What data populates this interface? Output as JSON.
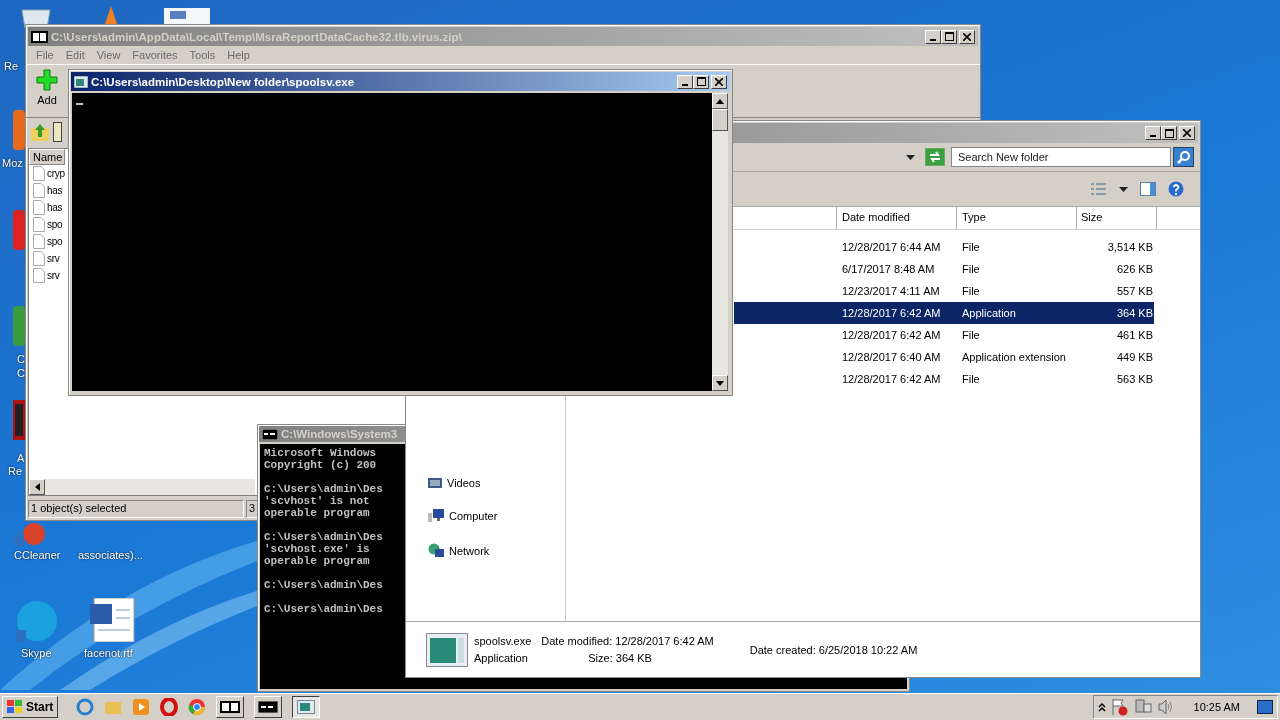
{
  "desktop_icons": [
    {
      "label": "Re"
    },
    {
      "label": "Moz"
    },
    {
      "label": "C"
    },
    {
      "label": "C"
    },
    {
      "label": "A"
    },
    {
      "label": "Re"
    },
    {
      "label": "CCleaner"
    },
    {
      "label": "associates)..."
    },
    {
      "label": "Skype"
    },
    {
      "label": "facenot.rtf"
    }
  ],
  "archive_window": {
    "title": "C:\\Users\\admin\\AppData\\Local\\Temp\\MsraReportDataCache32.tlb.virus.zip\\",
    "menu": [
      "File",
      "Edit",
      "View",
      "Favorites",
      "Tools",
      "Help"
    ],
    "add_label": "Add",
    "column": "Name",
    "files": [
      "cryp",
      "has",
      "has",
      "spo",
      "spo",
      "srv",
      "srv"
    ],
    "status": "1 object(s) selected",
    "status_2": "3"
  },
  "cmd_window": {
    "title": "C:\\Windows\\System3",
    "blocks": [
      [
        "Microsoft Windows",
        "Copyright (c) 200"
      ],
      [
        "C:\\Users\\admin\\Des",
        "'scvhost' is not",
        "operable program"
      ],
      [
        "C:\\Users\\admin\\Des",
        "'scvhost.exe' is",
        "operable program"
      ],
      [
        "C:\\Users\\admin\\Des"
      ],
      [
        "C:\\Users\\admin\\Des"
      ]
    ]
  },
  "explorer_window": {
    "search": {
      "placeholder": "Search New folder"
    },
    "columns": [
      "Date modified",
      "Type",
      "Size"
    ],
    "rows": [
      {
        "date": "12/28/2017 6:44 AM",
        "type": "File",
        "size": "3,514 KB",
        "selected": false
      },
      {
        "date": "6/17/2017 8:48 AM",
        "type": "File",
        "size": "626 KB",
        "selected": false
      },
      {
        "date": "12/23/2017 4:11 AM",
        "type": "File",
        "size": "557 KB",
        "selected": false
      },
      {
        "date": "12/28/2017 6:42 AM",
        "type": "Application",
        "size": "364 KB",
        "selected": true
      },
      {
        "date": "12/28/2017 6:42 AM",
        "type": "File",
        "size": "461 KB",
        "selected": false
      },
      {
        "date": "12/28/2017 6:40 AM",
        "type": "Application extension",
        "size": "449 KB",
        "selected": false
      },
      {
        "date": "12/28/2017 6:42 AM",
        "type": "File",
        "size": "563 KB",
        "selected": false
      }
    ],
    "nav": [
      {
        "kind": "videos",
        "label": "Videos"
      },
      {
        "kind": "computer",
        "label": "Computer"
      },
      {
        "kind": "network",
        "label": "Network"
      }
    ],
    "details": {
      "name": "spoolsv.exe",
      "type": "Application",
      "modified_label": "Date modified:",
      "modified": "12/28/2017 6:42 AM",
      "created_label": "Date created:",
      "created": "6/25/2018 10:22 AM",
      "size_label": "Size:",
      "size": "364 KB"
    }
  },
  "console_window": {
    "title": "C:\\Users\\admin\\Desktop\\New folder\\spoolsv.exe"
  },
  "taskbar": {
    "start": "Start",
    "clock": "10:25 AM"
  }
}
